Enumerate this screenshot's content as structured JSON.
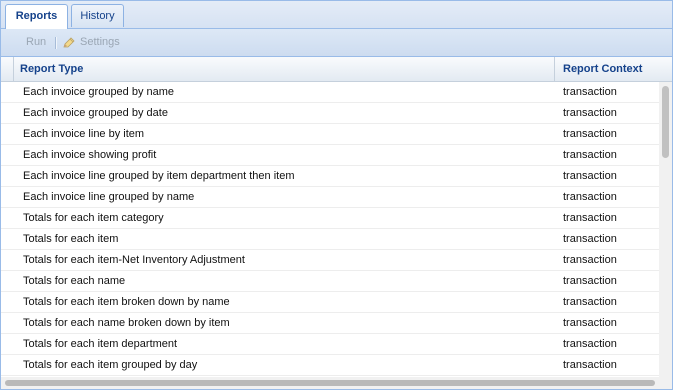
{
  "tabs": [
    {
      "label": "Reports",
      "active": true
    },
    {
      "label": "History",
      "active": false
    }
  ],
  "toolbar": {
    "run_label": "Run",
    "settings_label": "Settings",
    "settings_icon": "pencil-icon"
  },
  "grid": {
    "columns": [
      "Report Type",
      "Report Context"
    ],
    "rows": [
      {
        "type": "Each invoice grouped by name",
        "context": "transaction"
      },
      {
        "type": "Each invoice grouped by date",
        "context": "transaction"
      },
      {
        "type": "Each invoice line by item",
        "context": "transaction"
      },
      {
        "type": "Each invoice showing profit",
        "context": "transaction"
      },
      {
        "type": "Each invoice line grouped by item department then item",
        "context": "transaction"
      },
      {
        "type": "Each invoice line grouped by name",
        "context": "transaction"
      },
      {
        "type": "Totals for each item category",
        "context": "transaction"
      },
      {
        "type": "Totals for each item",
        "context": "transaction"
      },
      {
        "type": "Totals for each item-Net Inventory Adjustment",
        "context": "transaction"
      },
      {
        "type": "Totals for each name",
        "context": "transaction"
      },
      {
        "type": "Totals for each item broken down by name",
        "context": "transaction"
      },
      {
        "type": "Totals for each name broken down by item",
        "context": "transaction"
      },
      {
        "type": "Totals for each item department",
        "context": "transaction"
      },
      {
        "type": "Totals for each item grouped by day",
        "context": "transaction"
      }
    ]
  },
  "colors": {
    "accent": "#15428b",
    "border": "#99bbe8"
  }
}
